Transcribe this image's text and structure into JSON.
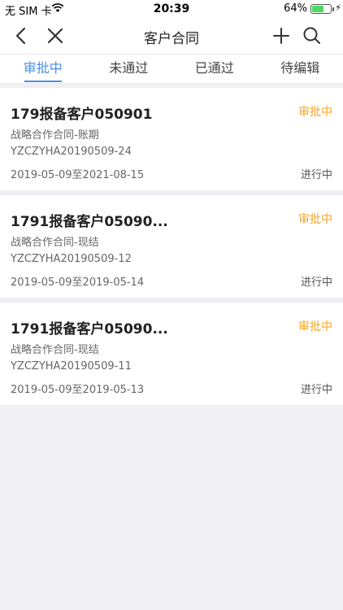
{
  "status_bar": {
    "carrier": "无 SIM 卡",
    "time": "20:39",
    "battery_pct": "64%",
    "battery_level": 0.64
  },
  "nav": {
    "title": "客户合同"
  },
  "tabs": [
    {
      "label": "审批中",
      "active": true
    },
    {
      "label": "未通过",
      "active": false
    },
    {
      "label": "已通过",
      "active": false
    },
    {
      "label": "待编辑",
      "active": false
    }
  ],
  "contracts": [
    {
      "name": "179报备客户050901",
      "status": "审批中",
      "type": "战略合作合同-账期",
      "code": "YZCZYHA20190509-24",
      "dates": "2019-05-09至2021-08-15",
      "progress": "进行中"
    },
    {
      "name": "1791报备客户05090...",
      "status": "审批中",
      "type": "战略合作合同-现结",
      "code": "YZCZYHA20190509-12",
      "dates": "2019-05-09至2019-05-14",
      "progress": "进行中"
    },
    {
      "name": "1791报备客户05090...",
      "status": "审批中",
      "type": "战略合作合同-现结",
      "code": "YZCZYHA20190509-11",
      "dates": "2019-05-09至2019-05-13",
      "progress": "进行中"
    }
  ]
}
